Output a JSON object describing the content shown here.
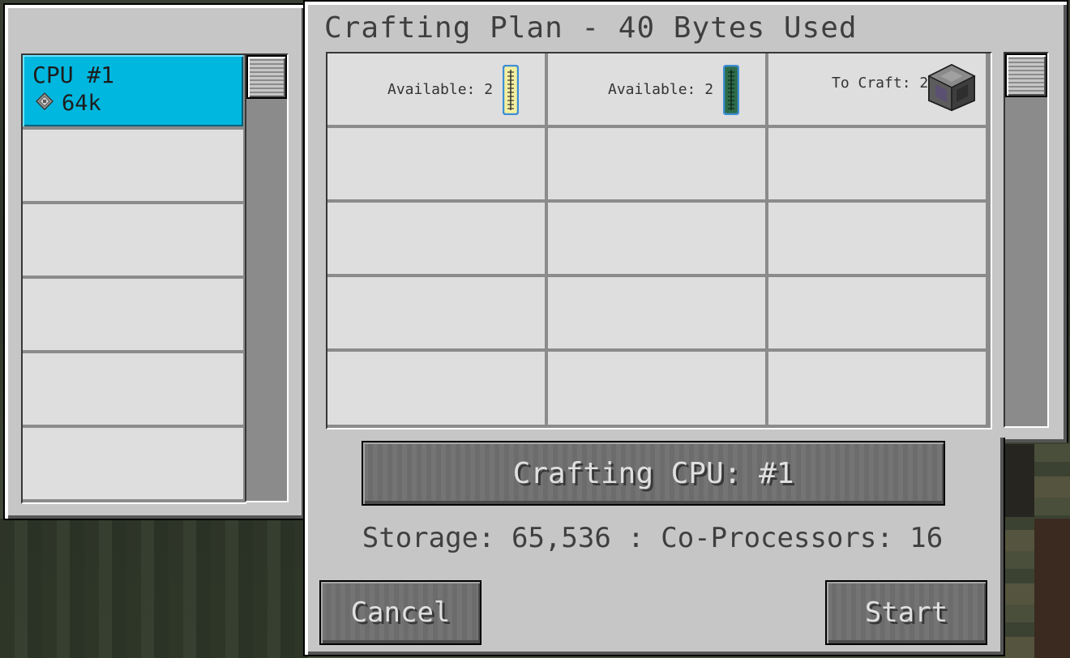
{
  "title": "Crafting Plan - 40 Bytes Used",
  "cpu_list": {
    "items": [
      {
        "name": "CPU #1",
        "size": "64k",
        "selected": true
      }
    ]
  },
  "plan": {
    "cells": [
      {
        "label": "Available: 2",
        "icon": "glass-cable-icon",
        "color": "#f5f0a0"
      },
      {
        "label": "Available: 2",
        "icon": "fluix-cable-icon",
        "color": "#2e6b4a"
      },
      {
        "label": "To Craft: 2",
        "icon": "interface-block-icon",
        "color": "#5a5a5a"
      }
    ]
  },
  "buttons": {
    "cpu_select": "Crafting CPU: #1",
    "cancel": "Cancel",
    "start": "Start"
  },
  "storage_info": "Storage: 65,536 : Co-Processors: 16",
  "colors": {
    "panel": "#c6c6c6",
    "selected_cpu": "#00b7df",
    "slot": "#dedede",
    "button": "#6f6f6f"
  }
}
